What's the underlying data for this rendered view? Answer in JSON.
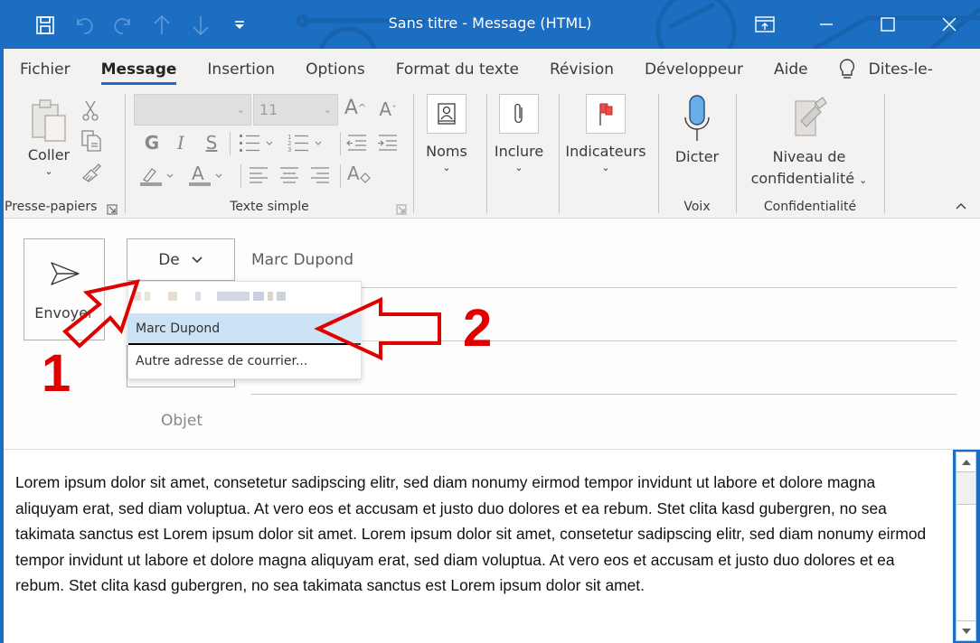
{
  "window": {
    "title": "Sans titre  -  Message (HTML)",
    "accent_color": "#1b6ec2"
  },
  "quick_access": [
    {
      "name": "save-icon",
      "enabled": true
    },
    {
      "name": "undo-icon",
      "enabled": false
    },
    {
      "name": "redo-icon",
      "enabled": false
    },
    {
      "name": "previous-item-icon",
      "enabled": false
    },
    {
      "name": "next-item-icon",
      "enabled": false
    },
    {
      "name": "customize-qat-icon",
      "enabled": true
    }
  ],
  "tabs": [
    {
      "label": "Fichier",
      "active": false
    },
    {
      "label": "Message",
      "active": true
    },
    {
      "label": "Insertion",
      "active": false
    },
    {
      "label": "Options",
      "active": false
    },
    {
      "label": "Format du texte",
      "active": false
    },
    {
      "label": "Révision",
      "active": false
    },
    {
      "label": "Développeur",
      "active": false
    },
    {
      "label": "Aide",
      "active": false
    }
  ],
  "tell_me": {
    "label": "Dites-le-"
  },
  "ribbon": {
    "clipboard": {
      "group_label": "Presse-papiers",
      "paste_label": "Coller"
    },
    "basic_text": {
      "group_label": "Texte simple",
      "font_name": "",
      "font_size": "11",
      "bold": "G",
      "italic": "I",
      "underline": "S"
    },
    "names": {
      "label": "Noms"
    },
    "include": {
      "label": "Inclure"
    },
    "tags": {
      "label": "Indicateurs"
    },
    "voice": {
      "group_label": "Voix",
      "dictate_label": "Dicter"
    },
    "sensitivity": {
      "group_label": "Confidentialité",
      "label_line1": "Niveau de",
      "label_line2": "confidentialité"
    }
  },
  "compose": {
    "send_label": "Envoyer",
    "from_button": "De",
    "from_value": "Marc Dupond",
    "subject_label": "Objet",
    "subject_value": ""
  },
  "from_dropdown": {
    "items": [
      {
        "label": "[blurred email address]",
        "blurred": true
      },
      {
        "label": "Marc Dupond",
        "selected": true
      },
      {
        "label": "Autre adresse de courrier..."
      }
    ]
  },
  "body": {
    "text": "Lorem ipsum dolor sit amet, consetetur sadipscing elitr, sed diam nonumy eirmod tempor invidunt ut labore et dolore magna aliquyam erat, sed diam voluptua. At vero eos et accusam et justo duo dolores et ea rebum. Stet clita kasd gubergren, no sea takimata sanctus est Lorem ipsum dolor sit amet. Lorem ipsum dolor sit amet, consetetur sadipscing elitr, sed diam nonumy eirmod tempor invidunt ut labore et dolore magna aliquyam erat, sed diam voluptua. At vero eos et accusam et justo duo dolores et ea rebum. Stet clita kasd gubergren, no sea takimata sanctus est Lorem ipsum dolor sit amet."
  },
  "annotations": {
    "step1": "1",
    "step2": "2",
    "color": "#e00000"
  }
}
